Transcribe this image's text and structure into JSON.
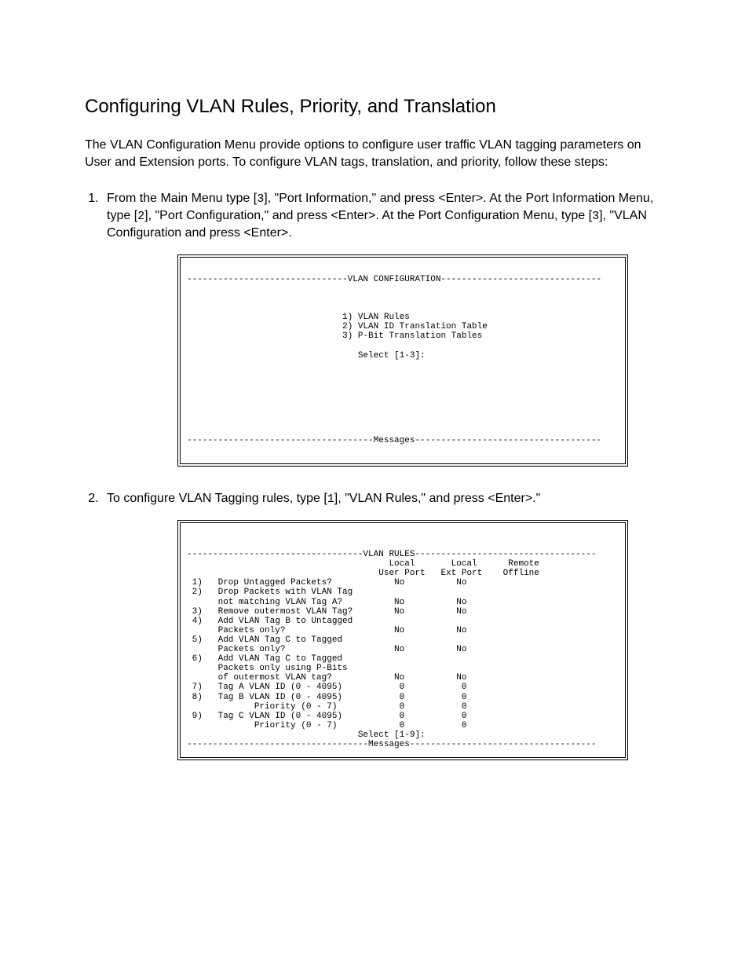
{
  "title": "Configuring VLAN Rules, Priority, and Translation",
  "intro": "The VLAN Configuration Menu provide options to configure user traffic VLAN tagging parameters on User and Extension ports. To configure VLAN tags, translation, and priority, follow these steps:",
  "step1_a": "From the Main Menu type [",
  "step1_b": "3",
  "step1_c": "], \"Port Information,\" and press <Enter>. At the Port Information Menu, type [",
  "step1_d": "2",
  "step1_e": "], \"Port Configuration,\" and press <Enter>. At the Port Configuration Menu, type [",
  "step1_f": "3",
  "step1_g": "], \"VLAN Configuration and press <Enter>.",
  "step2_a": "To configure VLAN Tagging rules, type [",
  "step2_b": "1",
  "step2_c": "], \"VLAN Rules,\" and press <Enter>.\"",
  "terminal1": "\n-------------------------------VLAN CONFIGURATION-------------------------------\n\n\n\n                              1) VLAN Rules\n                              2) VLAN ID Translation Table\n                              3) P-Bit Translation Tables\n\n                                 Select [1-3]:\n\n\n\n\n\n\n\n\n------------------------------------Messages------------------------------------\n",
  "terminal2": "\n\n----------------------------------VLAN RULES-----------------------------------\n                                       Local       Local      Remote\n                                     User Port   Ext Port    Offline\n 1)   Drop Untagged Packets?            No          No\n 2)   Drop Packets with VLAN Tag\n      not matching VLAN Tag A?          No          No\n 3)   Remove outermost VLAN Tag?        No          No\n 4)   Add VLAN Tag B to Untagged\n      Packets only?                     No          No\n 5)   Add VLAN Tag C to Tagged\n      Packets only?                     No          No\n 6)   Add VLAN Tag C to Tagged\n      Packets only using P-Bits\n      of outermost VLAN tag?            No          No\n 7)   Tag A VLAN ID (0 - 4095)           0           0\n 8)   Tag B VLAN ID (0 - 4095)           0           0\n             Priority (0 - 7)            0           0\n 9)   Tag C VLAN ID (0 - 4095)           0           0\n             Priority (0 - 7)            0           0\n                                 Select [1-9]:\n-----------------------------------Messages------------------------------------\n"
}
